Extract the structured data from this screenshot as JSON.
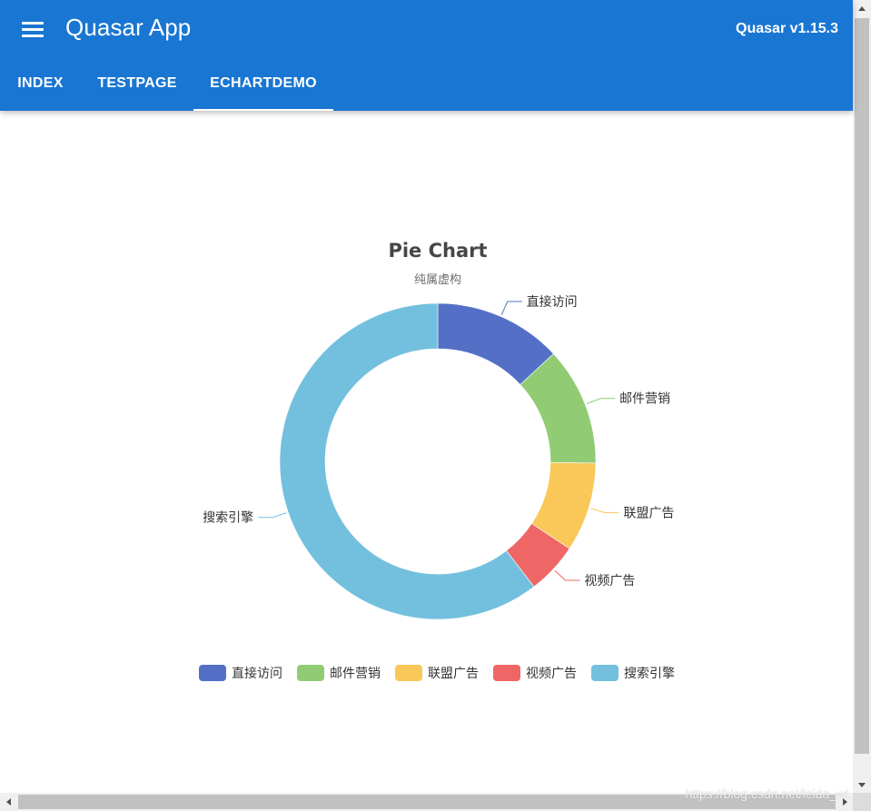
{
  "header": {
    "app_title": "Quasar App",
    "version": "Quasar v1.15.3",
    "menu_icon": "hamburger-menu-icon",
    "background_color": "#1976d2"
  },
  "tabs": [
    {
      "label": "INDEX",
      "active": false
    },
    {
      "label": "TESTPAGE",
      "active": false
    },
    {
      "label": "ECHARTDEMO",
      "active": true
    }
  ],
  "watermark": "https://blog.csdn.net/leida_wt",
  "chart_data": {
    "type": "pie",
    "donut": true,
    "title": "Pie Chart",
    "subtitle": "纯属虚构",
    "categories": [
      "直接访问",
      "邮件营销",
      "联盟广告",
      "视频广告",
      "搜索引擎"
    ],
    "values": [
      335,
      310,
      234,
      135,
      1548
    ],
    "colors": [
      "#5470c6",
      "#91cc75",
      "#fac858",
      "#ee6666",
      "#73c0de"
    ],
    "legend_position": "bottom-center"
  }
}
